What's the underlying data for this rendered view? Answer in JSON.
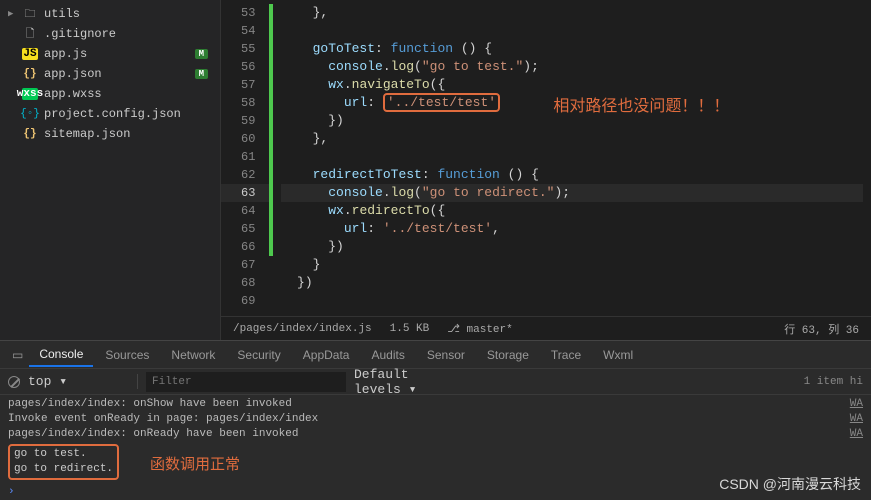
{
  "sidebar": {
    "items": [
      {
        "label": "utils",
        "type": "folder"
      },
      {
        "label": ".gitignore",
        "type": "file"
      },
      {
        "label": "app.js",
        "type": "js",
        "badge": "M"
      },
      {
        "label": "app.json",
        "type": "json",
        "badge": "M"
      },
      {
        "label": "app.wxss",
        "type": "wxss"
      },
      {
        "label": "project.config.json",
        "type": "config"
      },
      {
        "label": "sitemap.json",
        "type": "brace"
      }
    ]
  },
  "code": {
    "lines": [
      {
        "n": 53,
        "segs": [
          [
            "    ",
            "punc"
          ],
          [
            "},",
            "punc"
          ]
        ]
      },
      {
        "n": 54,
        "segs": []
      },
      {
        "n": 55,
        "segs": [
          [
            "    ",
            "punc"
          ],
          [
            "goToTest",
            "key"
          ],
          [
            ": ",
            "punc"
          ],
          [
            "function",
            "fn"
          ],
          [
            " () {",
            "punc"
          ]
        ]
      },
      {
        "n": 56,
        "segs": [
          [
            "      ",
            "punc"
          ],
          [
            "console",
            "key"
          ],
          [
            ".",
            "punc"
          ],
          [
            "log",
            "call"
          ],
          [
            "(",
            "punc"
          ],
          [
            "\"go to test.\"",
            "str"
          ],
          [
            ");",
            "punc"
          ]
        ]
      },
      {
        "n": 57,
        "segs": [
          [
            "      ",
            "punc"
          ],
          [
            "wx",
            "key"
          ],
          [
            ".",
            "punc"
          ],
          [
            "navigateTo",
            "call"
          ],
          [
            "({",
            "punc"
          ]
        ]
      },
      {
        "n": 58,
        "segs": [
          [
            "        ",
            "punc"
          ],
          [
            "url",
            "key"
          ],
          [
            ": ",
            "punc"
          ],
          [
            "'../test/test'",
            "str-box"
          ]
        ],
        "ann": "相对路径也没问题！！！"
      },
      {
        "n": 59,
        "segs": [
          [
            "      ",
            "punc"
          ],
          [
            "})",
            "punc"
          ]
        ]
      },
      {
        "n": 60,
        "segs": [
          [
            "    ",
            "punc"
          ],
          [
            "},",
            "punc"
          ]
        ]
      },
      {
        "n": 61,
        "segs": []
      },
      {
        "n": 62,
        "segs": [
          [
            "    ",
            "punc"
          ],
          [
            "redirectToTest",
            "key"
          ],
          [
            ": ",
            "punc"
          ],
          [
            "function",
            "fn"
          ],
          [
            " () {",
            "punc"
          ]
        ]
      },
      {
        "n": 63,
        "segs": [
          [
            "      ",
            "punc"
          ],
          [
            "console",
            "key"
          ],
          [
            ".",
            "punc"
          ],
          [
            "log",
            "call"
          ],
          [
            "(",
            "punc"
          ],
          [
            "\"go to redirect.\"",
            "str"
          ],
          [
            ");",
            "punc"
          ]
        ],
        "current": true
      },
      {
        "n": 64,
        "segs": [
          [
            "      ",
            "punc"
          ],
          [
            "wx",
            "key"
          ],
          [
            ".",
            "punc"
          ],
          [
            "redirectTo",
            "call"
          ],
          [
            "({",
            "punc"
          ]
        ]
      },
      {
        "n": 65,
        "segs": [
          [
            "        ",
            "punc"
          ],
          [
            "url",
            "key"
          ],
          [
            ": ",
            "punc"
          ],
          [
            "'../test/test'",
            "str"
          ],
          [
            ",",
            "punc"
          ]
        ]
      },
      {
        "n": 66,
        "segs": [
          [
            "      ",
            "punc"
          ],
          [
            "})",
            "punc"
          ]
        ]
      },
      {
        "n": 67,
        "segs": [
          [
            "    ",
            "punc"
          ],
          [
            "}",
            "punc"
          ]
        ]
      },
      {
        "n": 68,
        "segs": [
          [
            "  ",
            "punc"
          ],
          [
            "})",
            "punc"
          ]
        ]
      },
      {
        "n": 69,
        "segs": []
      }
    ],
    "modified_range": [
      53,
      66
    ]
  },
  "status": {
    "path": "/pages/index/index.js",
    "size": "1.5 KB",
    "branch": "master*",
    "cursor": "行 63, 列 36"
  },
  "panel": {
    "tabs": [
      "Console",
      "Sources",
      "Network",
      "Security",
      "AppData",
      "Audits",
      "Sensor",
      "Storage",
      "Trace",
      "Wxml"
    ],
    "active_tab": "Console",
    "context": "top",
    "filter_placeholder": "Filter",
    "levels": "Default levels ▾",
    "hidden": "1 item hi"
  },
  "console": {
    "rows": [
      {
        "msg": "pages/index/index: onShow have been invoked",
        "src": "WA"
      },
      {
        "msg": "Invoke event onReady in page: pages/index/index",
        "src": "WA"
      },
      {
        "msg": "pages/index/index: onReady have been invoked",
        "src": "WA"
      }
    ],
    "boxed_logs": [
      "go to test.",
      "go to redirect."
    ],
    "annotation": "函数调用正常"
  },
  "watermark": "CSDN @河南漫云科技"
}
